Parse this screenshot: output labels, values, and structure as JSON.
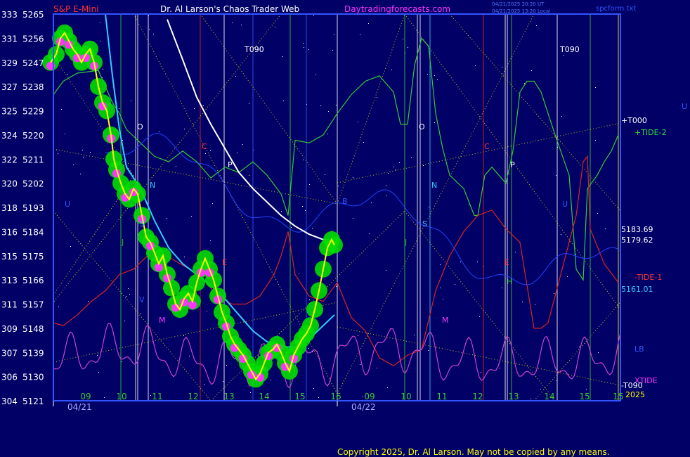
{
  "header": {
    "instrument": "S&P E-Mini",
    "author": "Dr. Al Larson's Chaos Trader Web",
    "site": "Daytradingforecasts.com",
    "stamp1": "04/21/2025 20:20 UT",
    "stamp2": "04/21/2025 13:20 Local",
    "file": "spcform.txt"
  },
  "footer": {
    "copyright": "Copyright 2025, Dr. Al Larson. May not be copied by any means."
  },
  "colors": {
    "background": "#000066",
    "frame": "#3355ff",
    "price": "#ffff00",
    "price_bg": "#00dd00",
    "magenta_dots": "#ff33ff",
    "cyan": "#33ccff",
    "white": "#ffffff",
    "green_line": "#33cc33",
    "red_line": "#dd2222",
    "violet_line": "#cc44cc",
    "blue_line": "#2244ff",
    "yellow_dotted": "#ffff00"
  },
  "chart_data": {
    "type": "line",
    "title": "S&P E-Mini",
    "ylim": [
      5121,
      5265
    ],
    "y_ticks_price": [
      5265,
      5256,
      5247,
      5238,
      5229,
      5220,
      5211,
      5202,
      5193,
      5184,
      5175,
      5166,
      5157,
      5148,
      5139,
      5130,
      5121
    ],
    "y_ticks_degrees": [
      333,
      331,
      329,
      327,
      325,
      324,
      322,
      320,
      318,
      316,
      315,
      313,
      311,
      309,
      307,
      306,
      304
    ],
    "x_ticks_hours": [
      "09",
      "10",
      "11",
      "12",
      "13",
      "14",
      "15",
      "16",
      "09",
      "10",
      "11",
      "12",
      "13",
      "14",
      "15",
      "15"
    ],
    "dates": [
      "04/21",
      "04/22"
    ],
    "right_labels": {
      "t000": "+T000",
      "tide2": "+TIDE-2",
      "price1": "5183.69",
      "price2": "5179.62",
      "tide1": "-TIDE-1",
      "price3": "5161.01",
      "lb": "LB",
      "xtide": "XTIDE",
      "t090": "-T090",
      "year": "2025",
      "u": "U"
    },
    "markers": {
      "t090a": "T090",
      "t090b": "T090",
      "o": "O",
      "c": "C",
      "p": "P",
      "n": "N",
      "s": "S",
      "j": "J",
      "m": "M",
      "v": "V",
      "e": "E",
      "h": "H",
      "u": "U",
      "b": "B"
    },
    "series": [
      {
        "name": "price",
        "points": [
          [
            72,
            5247
          ],
          [
            80,
            5250
          ],
          [
            86,
            5256
          ],
          [
            92,
            5258
          ],
          [
            98,
            5255
          ],
          [
            104,
            5252
          ],
          [
            110,
            5250
          ],
          [
            116,
            5247
          ],
          [
            122,
            5250
          ],
          [
            128,
            5252
          ],
          [
            134,
            5247
          ],
          [
            140,
            5238
          ],
          [
            146,
            5232
          ],
          [
            152,
            5229
          ],
          [
            158,
            5220
          ],
          [
            162,
            5211
          ],
          [
            166,
            5207
          ],
          [
            172,
            5202
          ],
          [
            178,
            5198
          ],
          [
            184,
            5196
          ],
          [
            190,
            5200
          ],
          [
            196,
            5198
          ],
          [
            202,
            5190
          ],
          [
            208,
            5182
          ],
          [
            214,
            5180
          ],
          [
            220,
            5176
          ],
          [
            226,
            5172
          ],
          [
            232,
            5175
          ],
          [
            238,
            5168
          ],
          [
            244,
            5163
          ],
          [
            250,
            5157
          ],
          [
            256,
            5155
          ],
          [
            262,
            5159
          ],
          [
            268,
            5161
          ],
          [
            274,
            5158
          ],
          [
            280,
            5165
          ],
          [
            286,
            5170
          ],
          [
            292,
            5174
          ],
          [
            298,
            5170
          ],
          [
            304,
            5166
          ],
          [
            310,
            5160
          ],
          [
            316,
            5154
          ],
          [
            322,
            5150
          ],
          [
            328,
            5145
          ],
          [
            334,
            5142
          ],
          [
            340,
            5140
          ],
          [
            346,
            5138
          ],
          [
            352,
            5135
          ],
          [
            358,
            5132
          ],
          [
            364,
            5129
          ],
          [
            370,
            5131
          ],
          [
            376,
            5135
          ],
          [
            382,
            5139
          ],
          [
            388,
            5140
          ],
          [
            394,
            5142
          ],
          [
            400,
            5139
          ],
          [
            406,
            5135
          ],
          [
            412,
            5132
          ],
          [
            418,
            5138
          ],
          [
            424,
            5141
          ],
          [
            430,
            5144
          ],
          [
            436,
            5146
          ],
          [
            442,
            5149
          ],
          [
            448,
            5155
          ],
          [
            454,
            5162
          ],
          [
            460,
            5170
          ],
          [
            466,
            5178
          ],
          [
            472,
            5181
          ],
          [
            476,
            5179
          ]
        ]
      },
      {
        "name": "cyan",
        "points": [
          [
            150,
            5265
          ],
          [
            160,
            5242
          ],
          [
            170,
            5222
          ],
          [
            180,
            5208
          ],
          [
            200,
            5200
          ],
          [
            220,
            5188
          ],
          [
            240,
            5178
          ],
          [
            260,
            5172
          ],
          [
            280,
            5168
          ],
          [
            300,
            5164
          ],
          [
            320,
            5159
          ],
          [
            340,
            5153
          ],
          [
            360,
            5147
          ],
          [
            380,
            5143
          ],
          [
            400,
            5141
          ],
          [
            420,
            5141
          ],
          [
            440,
            5144
          ],
          [
            460,
            5149
          ],
          [
            476,
            5153
          ]
        ]
      },
      {
        "name": "white",
        "points": [
          [
            238,
            5263
          ],
          [
            260,
            5248
          ],
          [
            280,
            5234
          ],
          [
            300,
            5224
          ],
          [
            320,
            5215
          ],
          [
            340,
            5206
          ],
          [
            360,
            5200
          ],
          [
            380,
            5195
          ],
          [
            400,
            5190
          ],
          [
            420,
            5186
          ],
          [
            440,
            5183
          ],
          [
            460,
            5181
          ],
          [
            480,
            5181
          ]
        ]
      },
      {
        "name": "tide2",
        "points": [
          [
            76,
            5235
          ],
          [
            90,
            5240
          ],
          [
            110,
            5243
          ],
          [
            140,
            5244
          ],
          [
            150,
            5238
          ],
          [
            160,
            5232
          ],
          [
            170,
            5228
          ],
          [
            180,
            5222
          ],
          [
            200,
            5217
          ],
          [
            220,
            5212
          ],
          [
            240,
            5210
          ],
          [
            260,
            5214
          ],
          [
            280,
            5210
          ],
          [
            300,
            5204
          ],
          [
            320,
            5208
          ],
          [
            340,
            5206
          ],
          [
            360,
            5210
          ],
          [
            380,
            5205
          ],
          [
            400,
            5198
          ],
          [
            410,
            5190
          ],
          [
            420,
            5218
          ],
          [
            440,
            5217
          ],
          [
            460,
            5220
          ],
          [
            470,
            5224
          ],
          [
            480,
            5228
          ],
          [
            500,
            5235
          ],
          [
            520,
            5240
          ],
          [
            540,
            5242
          ],
          [
            560,
            5236
          ],
          [
            570,
            5224
          ],
          [
            580,
            5224
          ],
          [
            590,
            5246
          ],
          [
            600,
            5256
          ],
          [
            610,
            5253
          ],
          [
            620,
            5228
          ],
          [
            630,
            5215
          ],
          [
            640,
            5205
          ],
          [
            660,
            5200
          ],
          [
            675,
            5190
          ],
          [
            680,
            5190
          ],
          [
            690,
            5205
          ],
          [
            700,
            5208
          ],
          [
            710,
            5205
          ],
          [
            720,
            5202
          ],
          [
            730,
            5214
          ],
          [
            740,
            5236
          ],
          [
            750,
            5240
          ],
          [
            760,
            5240
          ],
          [
            770,
            5236
          ],
          [
            790,
            5220
          ],
          [
            810,
            5205
          ],
          [
            820,
            5170
          ],
          [
            830,
            5166
          ],
          [
            836,
            5200
          ],
          [
            850,
            5205
          ],
          [
            860,
            5210
          ],
          [
            870,
            5214
          ],
          [
            880,
            5220
          ]
        ]
      },
      {
        "name": "tide1",
        "points": [
          [
            76,
            5150
          ],
          [
            90,
            5149
          ],
          [
            110,
            5153
          ],
          [
            130,
            5158
          ],
          [
            150,
            5162
          ],
          [
            170,
            5168
          ],
          [
            190,
            5170
          ],
          [
            210,
            5175
          ],
          [
            230,
            5176
          ],
          [
            250,
            5173
          ],
          [
            270,
            5170
          ],
          [
            290,
            5166
          ],
          [
            310,
            5160
          ],
          [
            330,
            5157
          ],
          [
            350,
            5157
          ],
          [
            370,
            5160
          ],
          [
            390,
            5168
          ],
          [
            400,
            5175
          ],
          [
            410,
            5184
          ],
          [
            420,
            5168
          ],
          [
            440,
            5160
          ],
          [
            460,
            5158
          ],
          [
            480,
            5165
          ],
          [
            500,
            5152
          ],
          [
            520,
            5147
          ],
          [
            540,
            5137
          ],
          [
            560,
            5134
          ],
          [
            580,
            5138
          ],
          [
            600,
            5140
          ],
          [
            620,
            5162
          ],
          [
            640,
            5175
          ],
          [
            660,
            5184
          ],
          [
            680,
            5190
          ],
          [
            700,
            5192
          ],
          [
            720,
            5185
          ],
          [
            740,
            5180
          ],
          [
            760,
            5148
          ],
          [
            770,
            5148
          ],
          [
            780,
            5150
          ],
          [
            800,
            5170
          ],
          [
            820,
            5190
          ],
          [
            830,
            5210
          ],
          [
            836,
            5212
          ],
          [
            840,
            5185
          ],
          [
            860,
            5172
          ],
          [
            880,
            5165
          ]
        ]
      }
    ]
  }
}
